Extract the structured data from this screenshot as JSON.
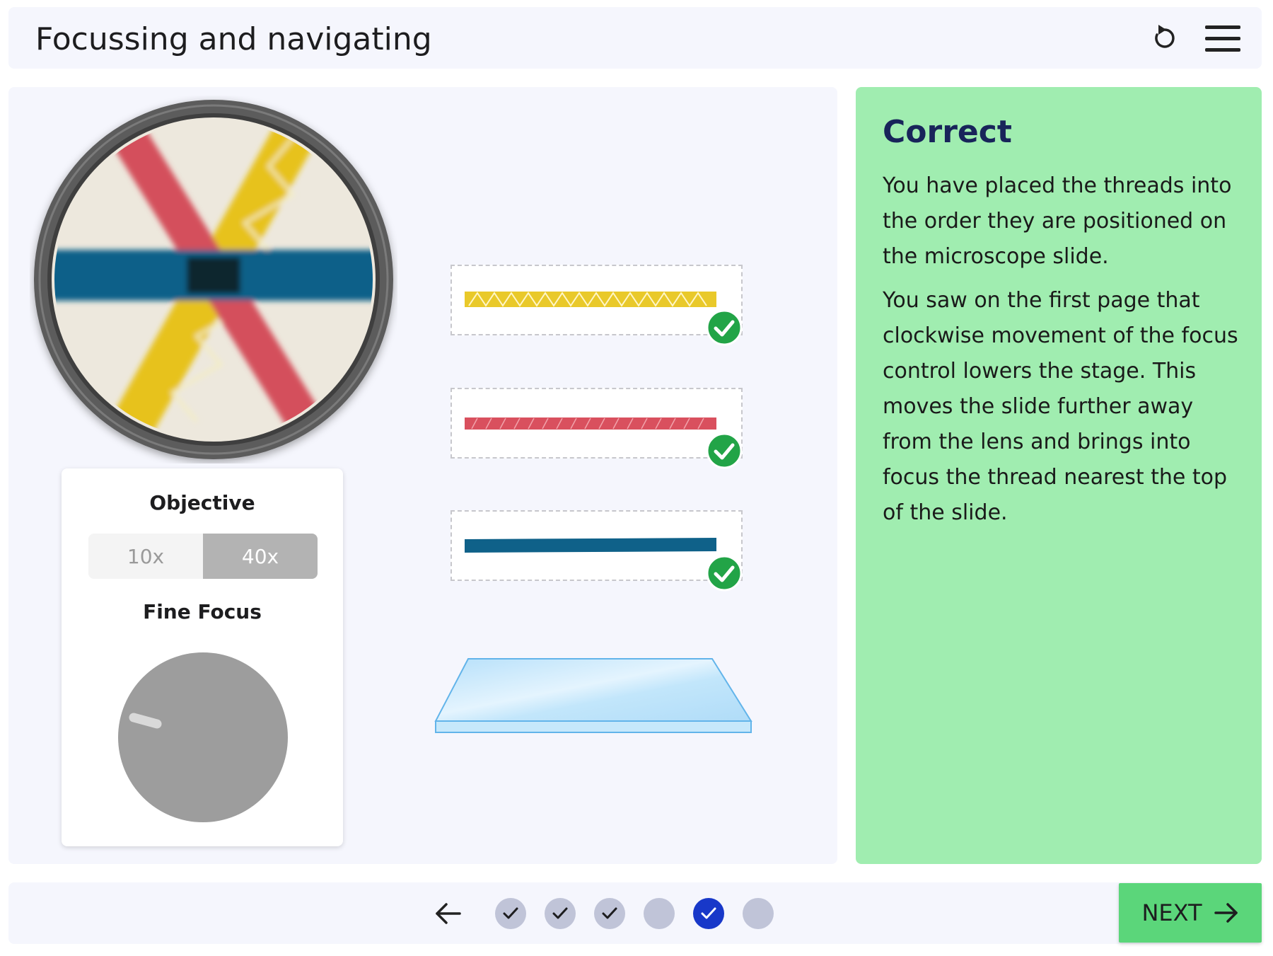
{
  "header": {
    "title": "Focussing and navigating"
  },
  "controls": {
    "objective_label": "Objective",
    "objective_options": [
      "10x",
      "40x"
    ],
    "objective_selected": "40x",
    "focus_label": "Fine Focus"
  },
  "threads": [
    {
      "color_name": "yellow",
      "color": "#e9c92a",
      "status": "correct"
    },
    {
      "color_name": "red",
      "color": "#d9505e",
      "status": "correct"
    },
    {
      "color_name": "blue",
      "color": "#0f6189",
      "status": "correct"
    }
  ],
  "feedback": {
    "title": "Correct",
    "paragraphs": [
      "You have placed the threads into the order they are positioned on the microscope slide.",
      "You saw on the first page that clockwise movement of the focus control lowers the stage. This moves the slide further away from the lens and brings into focus the thread nearest the top of the slide."
    ]
  },
  "footer": {
    "progress_dots": [
      "done",
      "done",
      "done",
      "todo",
      "current-done",
      "todo"
    ],
    "next_label": "NEXT"
  },
  "colors": {
    "panel_bg": "#f5f6fd",
    "feedback_bg": "#a0edb0",
    "feedback_title": "#18245a",
    "next_bg": "#5bd67a",
    "check_green": "#22a447",
    "current_dot": "#1838c9",
    "dot": "#c0c4d8"
  },
  "icons": [
    "reset-icon",
    "menu-icon",
    "back-arrow-icon",
    "next-arrow-icon",
    "check-icon"
  ]
}
